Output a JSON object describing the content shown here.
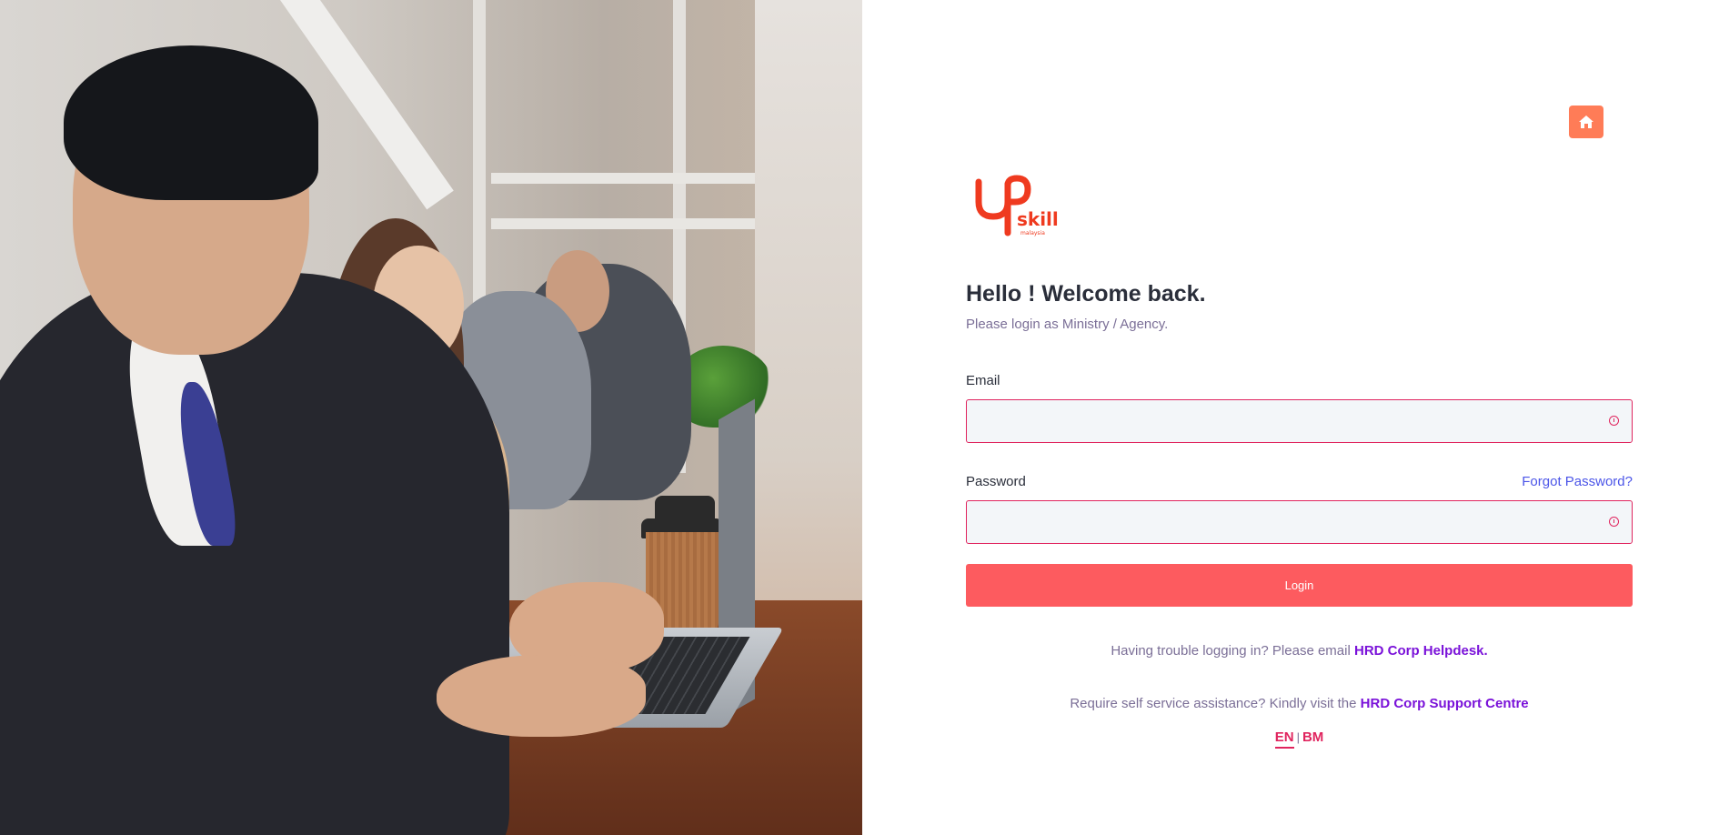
{
  "brand": {
    "logo_text": "up skill",
    "logo_subtext": "malaysia",
    "accent_color": "#fd5b5f",
    "home_button_color": "#ff7c57",
    "error_color": "#e0245e",
    "link_color": "#7a12d9"
  },
  "header": {
    "home_icon": "home-icon"
  },
  "login": {
    "title": "Hello ! Welcome back.",
    "subtitle": "Please login as Ministry / Agency.",
    "email_label": "Email",
    "email_value": "",
    "password_label": "Password",
    "password_value": "",
    "forgot_password": "Forgot Password?",
    "submit_label": "Login",
    "field_status_icon": "alert-circle-icon"
  },
  "help": {
    "trouble_text": "Having trouble logging in? Please email",
    "trouble_link": "HRD Corp Helpdesk.",
    "self_service_text": "Require self service assistance? Kindly visit the",
    "self_service_link": "HRD Corp Support Centre"
  },
  "language": {
    "options": [
      "EN",
      "BM"
    ],
    "selected": "EN",
    "separator": "|"
  }
}
